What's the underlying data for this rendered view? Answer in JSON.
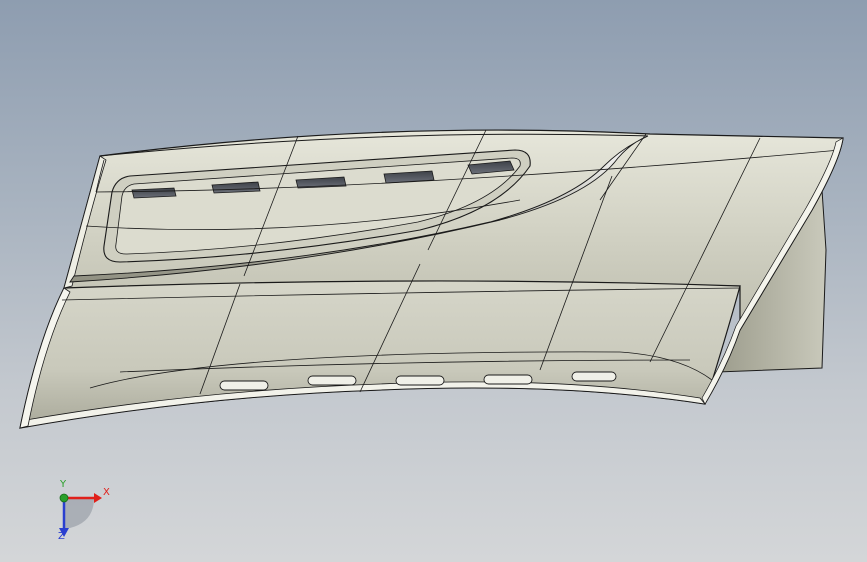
{
  "viewport": {
    "background_top": "#8e9db0",
    "background_bottom": "#d4d6d8"
  },
  "model": {
    "face_color": "#d3d3c5",
    "edge_color": "#1a1a1a"
  },
  "triad": {
    "x_label": "X",
    "y_label": "Y",
    "z_label": "Z",
    "x_color": "#e0201a",
    "y_color": "#2aa02a",
    "z_color": "#2a3fd0"
  }
}
